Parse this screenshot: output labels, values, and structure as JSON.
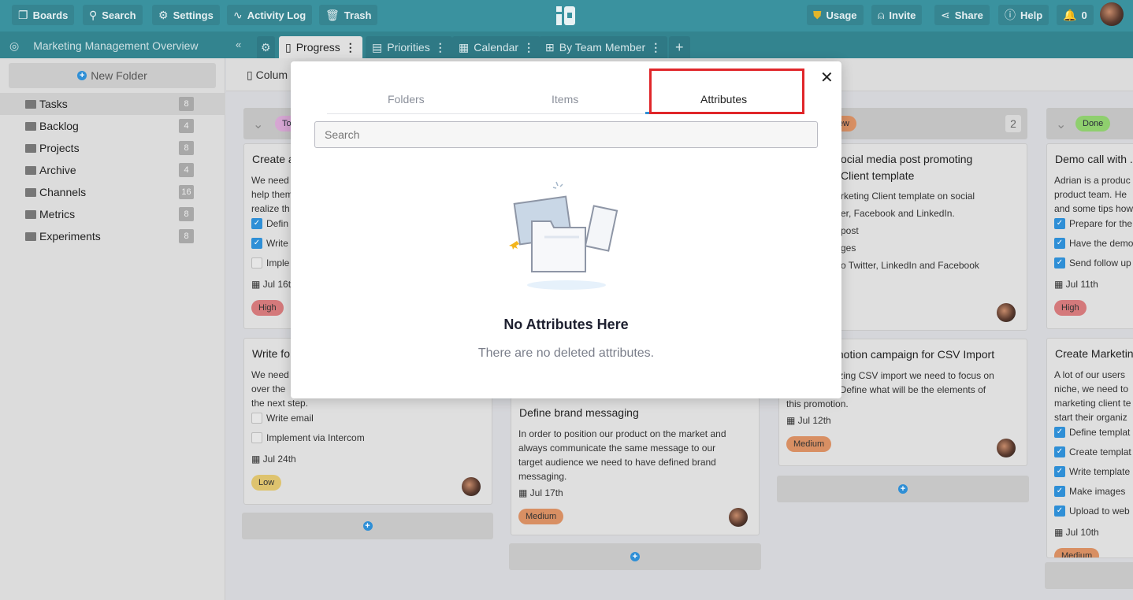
{
  "topbar": {
    "left": [
      {
        "icon": "boards-icon",
        "label": "Boards"
      },
      {
        "icon": "search-icon",
        "label": "Search"
      },
      {
        "icon": "gear-icon",
        "label": "Settings"
      },
      {
        "icon": "activity-icon",
        "label": "Activity Log"
      },
      {
        "icon": "trash-icon",
        "label": "Trash"
      }
    ],
    "right": [
      {
        "icon": "shield-icon",
        "label": "Usage"
      },
      {
        "icon": "add-user-icon",
        "label": "Invite"
      },
      {
        "icon": "share-icon",
        "label": "Share"
      },
      {
        "icon": "help-icon",
        "label": "Help"
      },
      {
        "icon": "bell-icon",
        "label": "0"
      }
    ]
  },
  "board": {
    "title": "Marketing Management Overview",
    "tabs": [
      {
        "label": "Progress",
        "icon": "columns-icon"
      },
      {
        "label": "Priorities",
        "icon": "list-icon"
      },
      {
        "label": "Calendar",
        "icon": "calendar-icon"
      },
      {
        "label": "By Team Member",
        "icon": "table-icon"
      }
    ]
  },
  "sidebar": {
    "new_folder": "New Folder",
    "folders": [
      {
        "name": "Tasks",
        "count": "8"
      },
      {
        "name": "Backlog",
        "count": "4"
      },
      {
        "name": "Projects",
        "count": "8"
      },
      {
        "name": "Archive",
        "count": "4"
      },
      {
        "name": "Channels",
        "count": "16"
      },
      {
        "name": "Metrics",
        "count": "8"
      },
      {
        "name": "Experiments",
        "count": "8"
      }
    ]
  },
  "toolbar": {
    "columns_label": "Colum"
  },
  "columns": {
    "c1": {
      "status": "To",
      "cards": [
        {
          "title": "Create a",
          "lines": [
            "We need",
            "help them",
            "realize th"
          ],
          "checks": [
            {
              "text": "Defin",
              "done": true
            },
            {
              "text": "Write",
              "done": true
            },
            {
              "text": "Imple",
              "done": false
            }
          ],
          "date": "Jul 16t",
          "priority": "High"
        },
        {
          "title": "Write fo",
          "lines": [
            "We need",
            "over the",
            "the next step."
          ],
          "checks": [
            {
              "text": "Write email",
              "done": false
            },
            {
              "text": "Implement via Intercom",
              "done": false
            }
          ],
          "date": "Jul 24th",
          "priority": "Low"
        }
      ]
    },
    "c2": {
      "cards": [
        {
          "title": "Define brand messaging",
          "lines": [
            "In order to position our product on the market and",
            "always communicate the same message to our",
            "target audience we need to have defined brand",
            "messaging."
          ],
          "date": "Jul 17th",
          "priority": "Medium"
        }
      ]
    },
    "c3": {
      "status": "view",
      "count": "2",
      "cards": [
        {
          "title": [
            "ocial media post promoting",
            "Client template"
          ],
          "lines": [
            "rketing Client template on social",
            "er, Facebook and LinkedIn.",
            "post",
            "ges",
            "o Twitter, LinkedIn and Facebook"
          ]
        },
        {
          "title": "motion campaign for CSV Import",
          "lines": [
            "lizing CSV import we need to focus on",
            ". Define what will be the elements of",
            "this promotion."
          ],
          "date": "Jul 12th",
          "priority": "Medium"
        }
      ]
    },
    "c4": {
      "status": "Done",
      "cards": [
        {
          "title": "Demo call with .",
          "lines": [
            "Adrian is a produc",
            "product team. He",
            "and some tips how"
          ],
          "checks": [
            {
              "text": "Prepare for the",
              "done": true
            },
            {
              "text": "Have the demo",
              "done": true
            },
            {
              "text": "Send follow up",
              "done": true
            }
          ],
          "date": "Jul 11th",
          "priority": "High"
        },
        {
          "title": "Create Marketin",
          "lines": [
            "A lot of our users",
            "niche, we need to",
            "marketing client te",
            "start their organiz"
          ],
          "checks": [
            {
              "text": "Define templat",
              "done": true
            },
            {
              "text": "Create templat",
              "done": true
            },
            {
              "text": "Write template",
              "done": true
            },
            {
              "text": "Make images",
              "done": true
            },
            {
              "text": "Upload to web",
              "done": true
            }
          ],
          "date": "Jul 10th",
          "priority": "Medium"
        }
      ]
    }
  },
  "modal": {
    "tabs": [
      "Folders",
      "Items",
      "Attributes"
    ],
    "active_tab": "Attributes",
    "search_placeholder": "Search",
    "empty_title": "No Attributes Here",
    "empty_text": "There are no deleted attributes.",
    "close_icon": "close-icon"
  },
  "colors": {
    "topbar": "#3a929f",
    "accent": "#2f8fd6",
    "high": "#d4797b",
    "medium": "#d88f63",
    "low": "#dec36e",
    "todo": "#d6a6d3",
    "done": "#8fcf6e",
    "highlight": "#e0262a"
  }
}
